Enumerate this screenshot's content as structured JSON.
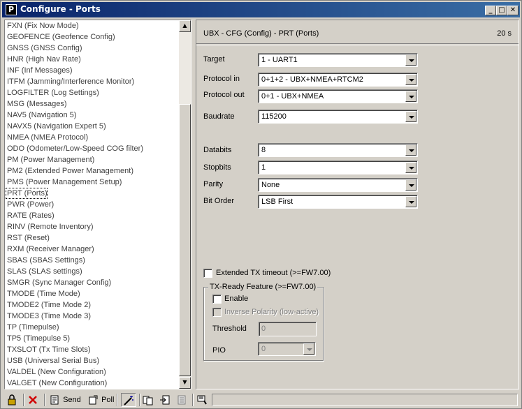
{
  "window": {
    "title": "Configure - Ports",
    "icon_letter": "P",
    "minimize_label": "_",
    "maximize_label": "□",
    "close_label": "✕"
  },
  "sidebar": {
    "items": [
      {
        "label": "FXN (Fix Now Mode)"
      },
      {
        "label": "GEOFENCE (Geofence Config)"
      },
      {
        "label": "GNSS (GNSS Config)"
      },
      {
        "label": "HNR (High Nav Rate)"
      },
      {
        "label": "INF (Inf Messages)"
      },
      {
        "label": "ITFM (Jamming/Interference Monitor)"
      },
      {
        "label": "LOGFILTER (Log Settings)"
      },
      {
        "label": "MSG (Messages)"
      },
      {
        "label": "NAV5 (Navigation 5)"
      },
      {
        "label": "NAVX5 (Navigation Expert 5)"
      },
      {
        "label": "NMEA (NMEA Protocol)"
      },
      {
        "label": "ODO (Odometer/Low-Speed COG filter)"
      },
      {
        "label": "PM (Power Management)"
      },
      {
        "label": "PM2 (Extended Power Management)"
      },
      {
        "label": "PMS (Power Management Setup)"
      },
      {
        "label": "PRT (Ports)"
      },
      {
        "label": "PWR (Power)"
      },
      {
        "label": "RATE (Rates)"
      },
      {
        "label": "RINV (Remote Inventory)"
      },
      {
        "label": "RST (Reset)"
      },
      {
        "label": "RXM (Receiver Manager)"
      },
      {
        "label": "SBAS (SBAS Settings)"
      },
      {
        "label": "SLAS (SLAS settings)"
      },
      {
        "label": "SMGR (Sync Manager Config)"
      },
      {
        "label": "TMODE (Time Mode)"
      },
      {
        "label": "TMODE2 (Time Mode 2)"
      },
      {
        "label": "TMODE3 (Time Mode 3)"
      },
      {
        "label": "TP (Timepulse)"
      },
      {
        "label": "TP5 (Timepulse 5)"
      },
      {
        "label": "TXSLOT (Tx Time Slots)"
      },
      {
        "label": "USB (Universal Serial Bus)"
      },
      {
        "label": "VALDEL (New Configuration)"
      },
      {
        "label": "VALGET (New Configuration)"
      }
    ],
    "selected_label": "PRT (Ports)"
  },
  "panel": {
    "title": "UBX - CFG (Config) - PRT (Ports)",
    "age": "20 s",
    "fields": {
      "target": {
        "label": "Target",
        "value": "1 - UART1"
      },
      "protocol_in": {
        "label": "Protocol in",
        "value": "0+1+2 - UBX+NMEA+RTCM2"
      },
      "protocol_out": {
        "label": "Protocol out",
        "value": "0+1 - UBX+NMEA"
      },
      "baudrate": {
        "label": "Baudrate",
        "value": "115200"
      },
      "databits": {
        "label": "Databits",
        "value": "8"
      },
      "stopbits": {
        "label": "Stopbits",
        "value": "1"
      },
      "parity": {
        "label": "Parity",
        "value": "None"
      },
      "bit_order": {
        "label": "Bit Order",
        "value": "LSB First"
      }
    },
    "extended_tx": {
      "label": "Extended TX timeout (>=FW7.00)",
      "checked": false
    },
    "tx_ready": {
      "group_label": "TX-Ready Feature (>=FW7.00)",
      "enable_label": "Enable",
      "inverse_label": "Inverse Polarity (low-active)",
      "threshold_label": "Threshold",
      "threshold_value": "0",
      "pio_label": "PIO",
      "pio_value": "0"
    }
  },
  "toolbar": {
    "send_label": "Send",
    "poll_label": "Poll"
  }
}
